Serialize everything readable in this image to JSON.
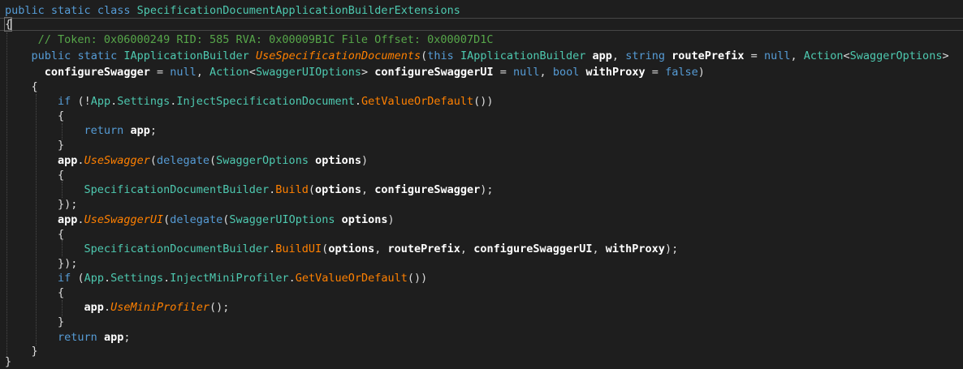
{
  "code": {
    "line1": {
      "k1": "public",
      "k2": "static",
      "k3": "class",
      "class_name": "SpecificationDocumentApplicationBuilderExtensions"
    },
    "line2": {
      "brace": "{"
    },
    "line3": {
      "comment": "// Token: 0x06000249 RID: 585 RVA: 0x00009B1C File Offset: 0x00007D1C"
    },
    "line4": {
      "k1": "public",
      "k2": "static",
      "t1": "IApplicationBuilder",
      "method": "UseSpecificationDocuments",
      "p1": "(",
      "k3": "this",
      "t2": "IApplicationBuilder",
      "a1": "app",
      "p2": ",",
      "k4": "string",
      "a2": "routePrefix",
      "p3": "=",
      "k5": "null",
      "p4": ",",
      "t3": "Action",
      "p5": "<",
      "t4": "SwaggerOptions",
      "p6": ">"
    },
    "line5": {
      "a1": "configureSwagger",
      "p1": "=",
      "k1": "null",
      "p2": ",",
      "t1": "Action",
      "p3": "<",
      "t2": "SwaggerUIOptions",
      "p4": ">",
      "a2": "configureSwaggerUI",
      "p5": "=",
      "k2": "null",
      "p6": ",",
      "k3": "bool",
      "a3": "withProxy",
      "p7": "=",
      "k4": "false",
      "p8": ")"
    },
    "line6": {
      "brace": "{"
    },
    "line7": {
      "k1": "if",
      "p1": "(!",
      "t1": "App",
      "p2": ".",
      "pr1": "Settings",
      "p3": ".",
      "pr2": "InjectSpecificationDocument",
      "p4": ".",
      "m1": "GetValueOrDefault",
      "p5": "())"
    },
    "line8": {
      "brace": "{"
    },
    "line9": {
      "k1": "return",
      "a1": "app",
      "p1": ";"
    },
    "line10": {
      "brace": "}"
    },
    "line11": {
      "a1": "app",
      "p1": ".",
      "method": "UseSwagger",
      "p2": "(",
      "k1": "delegate",
      "p3": "(",
      "t1": "SwaggerOptions",
      "a2": "options",
      "p4": ")"
    },
    "line12": {
      "brace": "{"
    },
    "line13": {
      "t1": "SpecificationDocumentBuilder",
      "p1": ".",
      "m1": "Build",
      "p2": "(",
      "a1": "options",
      "p3": ",",
      "a2": "configureSwagger",
      "p4": ");"
    },
    "line14": {
      "text": "});"
    },
    "line15": {
      "a1": "app",
      "p1": ".",
      "method": "UseSwaggerUI",
      "p2": "(",
      "k1": "delegate",
      "p3": "(",
      "t1": "SwaggerUIOptions",
      "a2": "options",
      "p4": ")"
    },
    "line16": {
      "brace": "{"
    },
    "line17": {
      "t1": "SpecificationDocumentBuilder",
      "p1": ".",
      "m1": "BuildUI",
      "p2": "(",
      "a1": "options",
      "p3": ",",
      "a2": "routePrefix",
      "p4": ",",
      "a3": "configureSwaggerUI",
      "p5": ",",
      "a4": "withProxy",
      "p6": ");"
    },
    "line18": {
      "text": "});"
    },
    "line19": {
      "k1": "if",
      "p1": "(",
      "t1": "App",
      "p2": ".",
      "pr1": "Settings",
      "p3": ".",
      "pr2": "InjectMiniProfiler",
      "p4": ".",
      "m1": "GetValueOrDefault",
      "p5": "())"
    },
    "line20": {
      "brace": "{"
    },
    "line21": {
      "a1": "app",
      "p1": ".",
      "method": "UseMiniProfiler",
      "p2": "();"
    },
    "line22": {
      "brace": "}"
    },
    "line23": {
      "k1": "return",
      "a1": "app",
      "p1": ";"
    },
    "line24": {
      "brace": "}"
    },
    "line25": {
      "brace": "}"
    }
  },
  "colors": {
    "background": "#1e1e1e",
    "keyword": "#569cd6",
    "type": "#4ec9b0",
    "comment": "#57a64a",
    "method": "#ff8000",
    "property": "#d69d85",
    "parameter": "#ffffff",
    "punctuation": "#dcdcdc"
  }
}
